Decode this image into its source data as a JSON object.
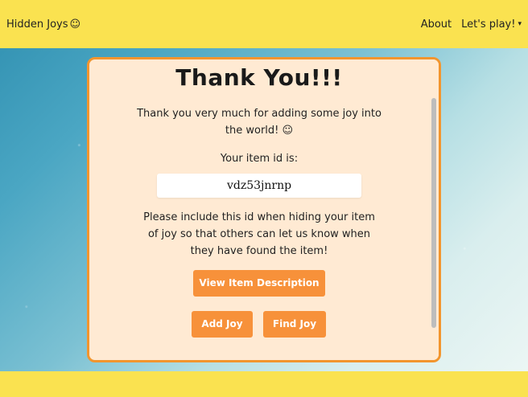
{
  "navbar": {
    "brand": "Hidden Joys",
    "brand_emoji": "☺",
    "about": "About",
    "play": "Let's play!",
    "play_chevron": "▾"
  },
  "card": {
    "title": "Thank You!!!",
    "thanks_text": "Thank you very much for adding some joy into the world! ☺",
    "id_label": "Your item id is:",
    "item_id": "vdz53jnrnp",
    "note": "Please include this id when hiding your item of joy so that others can let us know when they have found the item!",
    "buttons": {
      "view": "View Item Description",
      "add": "Add Joy",
      "find": "Find Joy"
    }
  },
  "colors": {
    "navbar": "#fae250",
    "card_bg": "#ffead3",
    "card_border": "#f2952e",
    "button": "#f7913a"
  },
  "icons": {
    "brand": "smiley-icon",
    "dropdown": "chevron-down-icon"
  }
}
